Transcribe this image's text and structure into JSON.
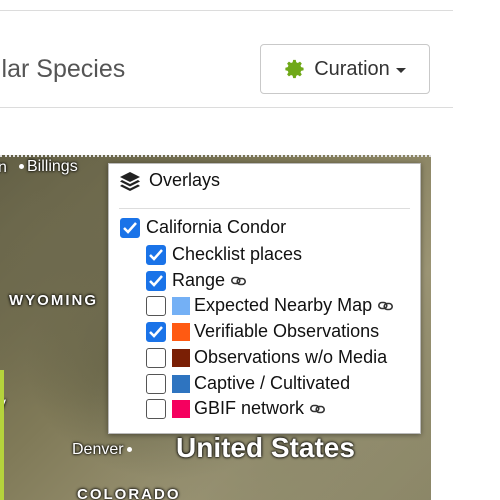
{
  "header": {
    "title": "ilar Species",
    "curation_button": "Curation"
  },
  "map": {
    "labels": {
      "billings": "Billings",
      "wyoming": "WYOMING",
      "denver": "Denver",
      "united_states": "United States",
      "colorado": "COLORADO",
      "edge_n": "n",
      "edge_y": "y"
    }
  },
  "overlays": {
    "title": "Overlays",
    "taxon": {
      "label": "California Condor",
      "checked": true
    },
    "items": [
      {
        "label": "Checklist places",
        "checked": true,
        "swatch": null,
        "link": false
      },
      {
        "label": "Range",
        "checked": true,
        "swatch": null,
        "link": true
      },
      {
        "label": "Expected Nearby Map",
        "checked": false,
        "swatch": "#74b0f5",
        "link": true
      },
      {
        "label": "Verifiable Observations",
        "checked": true,
        "swatch": "#ff5a12",
        "link": false
      },
      {
        "label": "Observations w/o Media",
        "checked": false,
        "swatch": "#7a1f05",
        "link": false
      },
      {
        "label": "Captive / Cultivated",
        "checked": false,
        "swatch": "#2e74c0",
        "link": false
      },
      {
        "label": "GBIF network",
        "checked": false,
        "swatch": "#f5005f",
        "link": true
      }
    ]
  },
  "colors": {
    "checkbox_checked": "#1a73e8",
    "gear_icon": "#6fa818"
  }
}
